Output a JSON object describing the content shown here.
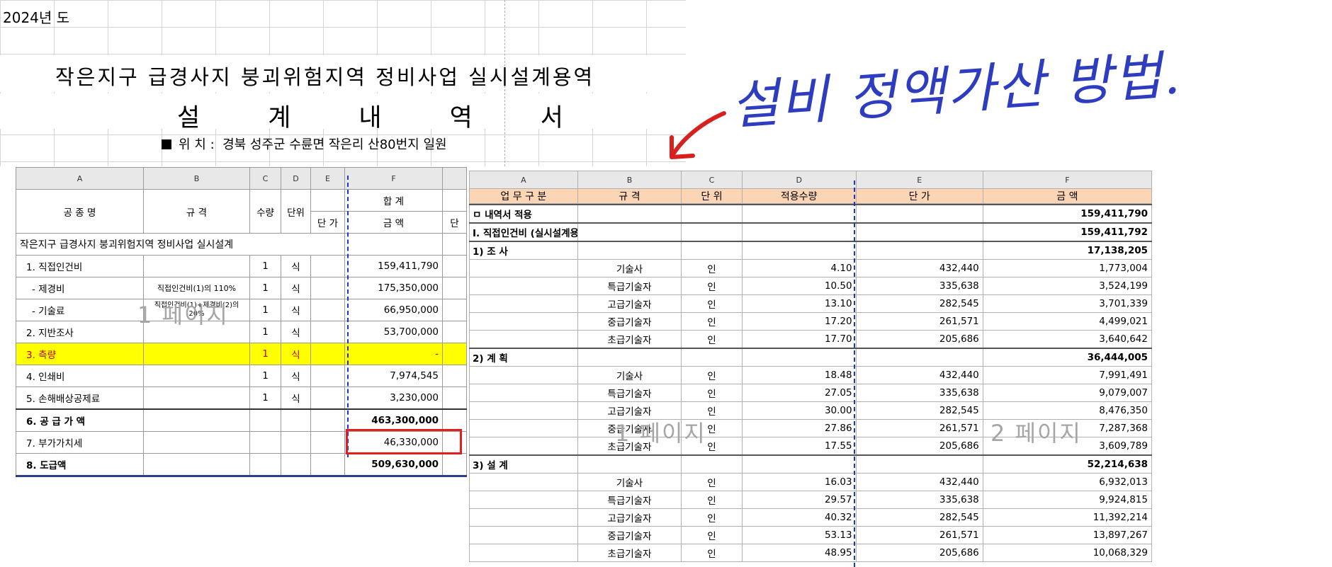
{
  "top": {
    "year": "2024년 도",
    "title_line1": "작은지구 급경사지 붕괴위험지역 정비사업 실시설계용역",
    "title_line2": "설계내역서",
    "location_label": "위 치 :",
    "location_value": "경북 성주군 수륜면 작은리 산80번지 일원"
  },
  "annotation": {
    "text": "설비 정액가산 방법.",
    "arrow_icon": "red-arrow-icon",
    "color": "#2e3dbf"
  },
  "left_sheet": {
    "col_letters": [
      "A",
      "B",
      "C",
      "D",
      "E",
      "F"
    ],
    "headers": {
      "name": "공 종 명",
      "spec": "규 격",
      "qty": "수량",
      "unit": "단위",
      "total": "합 계",
      "unit_price": "단 가",
      "amount": "금 액",
      "extra": "단"
    },
    "project_title": "작은지구 급경사지 붕괴위험지역 정비사업 실시설계",
    "rows": [
      {
        "name": "1. 직접인건비",
        "spec": "",
        "qty": "1",
        "unit": "식",
        "amount": "159,411,790"
      },
      {
        "name": "- 제경비",
        "spec": "직접인건비(1)의 110%",
        "qty": "1",
        "unit": "식",
        "amount": "175,350,000"
      },
      {
        "name": "- 기술료",
        "spec": "직접인건비(1)+제경비(2)의 20%",
        "qty": "1",
        "unit": "식",
        "amount": "66,950,000"
      },
      {
        "name": "2. 지반조사",
        "spec": "",
        "qty": "1",
        "unit": "식",
        "amount": "53,700,000"
      },
      {
        "name": "3. 측량",
        "spec": "",
        "qty": "1",
        "unit": "식",
        "amount": "-"
      },
      {
        "name": "4. 인쇄비",
        "spec": "",
        "qty": "1",
        "unit": "식",
        "amount": "7,974,545"
      },
      {
        "name": "5. 손해배상공제료",
        "spec": "",
        "qty": "1",
        "unit": "식",
        "amount": "3,230,000"
      },
      {
        "name": "6. 공 급 가 액",
        "spec": "",
        "qty": "",
        "unit": "",
        "amount": "463,300,000"
      },
      {
        "name": "7. 부가가치세",
        "spec": "",
        "qty": "",
        "unit": "",
        "amount": "46,330,000"
      },
      {
        "name": "8. 도급액",
        "spec": "",
        "qty": "",
        "unit": "",
        "amount": "509,630,000"
      }
    ],
    "watermark": "1 페이지"
  },
  "right_sheet": {
    "col_letters": [
      "A",
      "B",
      "C",
      "D",
      "E",
      "F"
    ],
    "headers": [
      "업 무 구 분",
      "규 격",
      "단 위",
      "적용수량",
      "단 가",
      "금 액"
    ],
    "rows": [
      {
        "a": "ㅁ 내역서 적용",
        "b": "",
        "c": "",
        "d": "",
        "e": "",
        "f": "159,411,790",
        "bold": true
      },
      {
        "a": "Ⅰ. 직접인건비 (실시설계용역)",
        "b": "",
        "c": "",
        "d": "",
        "e": "",
        "f": "159,411,792",
        "bold": true
      },
      {
        "a": "1) 조 사",
        "b": "",
        "c": "",
        "d": "",
        "e": "",
        "f": "17,138,205",
        "bold": true
      },
      {
        "a": "",
        "b": "기술사",
        "c": "인",
        "d": "4.10",
        "e": "432,440",
        "f": "1,773,004"
      },
      {
        "a": "",
        "b": "특급기술자",
        "c": "인",
        "d": "10.50",
        "e": "335,638",
        "f": "3,524,199"
      },
      {
        "a": "",
        "b": "고급기술자",
        "c": "인",
        "d": "13.10",
        "e": "282,545",
        "f": "3,701,339"
      },
      {
        "a": "",
        "b": "중급기술자",
        "c": "인",
        "d": "17.20",
        "e": "261,571",
        "f": "4,499,021"
      },
      {
        "a": "",
        "b": "초급기술자",
        "c": "인",
        "d": "17.70",
        "e": "205,686",
        "f": "3,640,642"
      },
      {
        "a": "2) 계 획",
        "b": "",
        "c": "",
        "d": "",
        "e": "",
        "f": "36,444,005",
        "bold": true
      },
      {
        "a": "",
        "b": "기술사",
        "c": "인",
        "d": "18.48",
        "e": "432,440",
        "f": "7,991,491"
      },
      {
        "a": "",
        "b": "특급기술자",
        "c": "인",
        "d": "27.05",
        "e": "335,638",
        "f": "9,079,007"
      },
      {
        "a": "",
        "b": "고급기술자",
        "c": "인",
        "d": "30.00",
        "e": "282,545",
        "f": "8,476,350"
      },
      {
        "a": "",
        "b": "중급기술자",
        "c": "인",
        "d": "27.86",
        "e": "261,571",
        "f": "7,287,368"
      },
      {
        "a": "",
        "b": "초급기술자",
        "c": "인",
        "d": "17.55",
        "e": "205,686",
        "f": "3,609,789"
      },
      {
        "a": "3) 설 계",
        "b": "",
        "c": "",
        "d": "",
        "e": "",
        "f": "52,214,638",
        "bold": true
      },
      {
        "a": "",
        "b": "기술사",
        "c": "인",
        "d": "16.03",
        "e": "432,440",
        "f": "6,932,013"
      },
      {
        "a": "",
        "b": "특급기술자",
        "c": "인",
        "d": "29.57",
        "e": "335,638",
        "f": "9,924,815"
      },
      {
        "a": "",
        "b": "고급기술자",
        "c": "인",
        "d": "40.32",
        "e": "282,545",
        "f": "11,392,214"
      },
      {
        "a": "",
        "b": "중급기술자",
        "c": "인",
        "d": "53.13",
        "e": "261,571",
        "f": "13,897,267"
      },
      {
        "a": "",
        "b": "초급기술자",
        "c": "인",
        "d": "48.95",
        "e": "205,686",
        "f": "10,068,329"
      }
    ],
    "watermark1": "1 페이지",
    "watermark2": "2 페이지"
  }
}
